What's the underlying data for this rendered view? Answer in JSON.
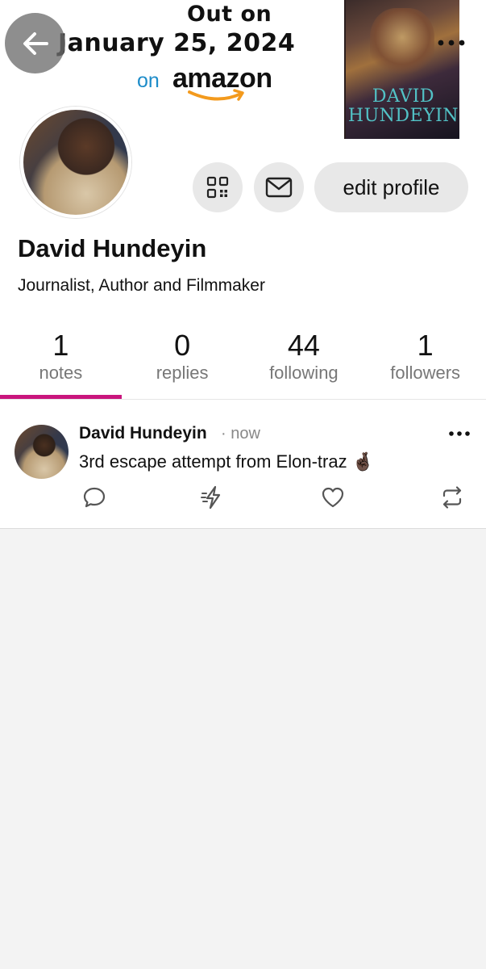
{
  "banner": {
    "line1": "Out on",
    "line2": "January 25, 2024",
    "on": "on",
    "amazon": "amazon",
    "book_title": "DAVID HUNDEYIN"
  },
  "profile": {
    "name": "David Hundeyin",
    "bio": "Journalist, Author and Filmmaker",
    "edit_label": "edit profile"
  },
  "stats": [
    {
      "value": "1",
      "label": "notes",
      "active": true
    },
    {
      "value": "0",
      "label": "replies",
      "active": false
    },
    {
      "value": "44",
      "label": "following",
      "active": false
    },
    {
      "value": "1",
      "label": "followers",
      "active": false
    }
  ],
  "note": {
    "author": "David Hundeyin",
    "time": "· now",
    "text": "3rd escape attempt from Elon-traz 🤞🏿"
  },
  "colors": {
    "accent": "#c9157d",
    "button_bg": "#e8e8e8",
    "muted_text": "#777777",
    "page_bg": "#f3f3f3"
  },
  "icons": [
    "back-arrow-icon",
    "more-horizontal-icon",
    "qr-code-icon",
    "mail-icon",
    "comment-icon",
    "restack-bolt-icon",
    "heart-icon",
    "repost-icon"
  ]
}
